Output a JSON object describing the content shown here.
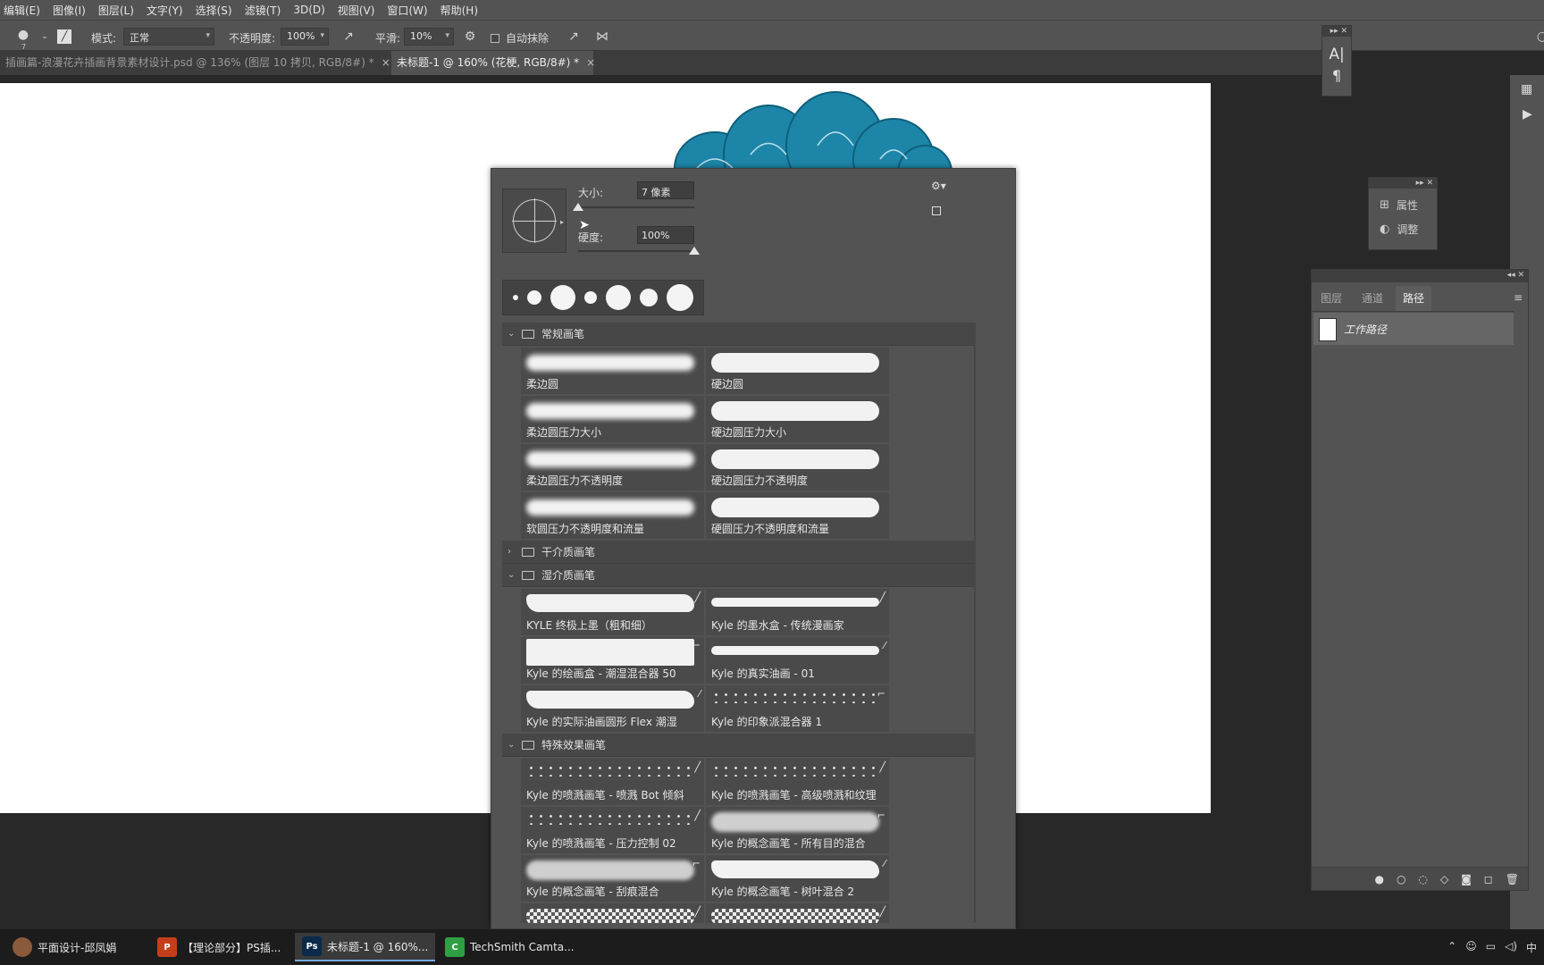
{
  "menu": [
    "编辑(E)",
    "图像(I)",
    "图层(L)",
    "文字(Y)",
    "选择(S)",
    "滤镜(T)",
    "3D(D)",
    "视图(V)",
    "窗口(W)",
    "帮助(H)"
  ],
  "options": {
    "brush_size_small": "7",
    "mode_label": "模式:",
    "mode_value": "正常",
    "opacity_label": "不透明度:",
    "opacity_value": "100%",
    "smooth_label": "平滑:",
    "smooth_value": "10%",
    "auto_erase_label": "自动抹除"
  },
  "tabs": [
    {
      "label": "插画篇-浪漫花卉插画背景素材设计.psd @ 136% (图层 10 拷贝, RGB/8#) *",
      "active": false
    },
    {
      "label": "未标题-1 @ 160% (花梗, RGB/8#) *",
      "active": true
    }
  ],
  "brush_panel": {
    "size_label": "大小:",
    "size_value": "7 像素",
    "hardness_label": "硬度:",
    "hardness_value": "100%",
    "size_fraction": 0.0,
    "hardness_fraction": 1.0,
    "groups": [
      {
        "name": "常规画笔",
        "expanded": true,
        "brushes": [
          {
            "name": "柔边圆",
            "style": "soft",
            "mark": ""
          },
          {
            "name": "硬边圆",
            "style": "hard",
            "mark": ""
          },
          {
            "name": "柔边圆压力大小",
            "style": "soft",
            "mark": ""
          },
          {
            "name": "硬边圆压力大小",
            "style": "hard",
            "mark": ""
          },
          {
            "name": "柔边圆压力不透明度",
            "style": "soft",
            "mark": ""
          },
          {
            "name": "硬边圆压力不透明度",
            "style": "hard",
            "mark": ""
          },
          {
            "name": "软圆压力不透明度和流量",
            "style": "soft",
            "mark": ""
          },
          {
            "name": "硬圆压力不透明度和流量",
            "style": "hard",
            "mark": ""
          }
        ]
      },
      {
        "name": "干介质画笔",
        "expanded": false,
        "brushes": []
      },
      {
        "name": "湿介质画笔",
        "expanded": true,
        "brushes": [
          {
            "name": "KYLE 终极上墨（粗和细）",
            "style": "rough",
            "mark": "╱"
          },
          {
            "name": "Kyle 的墨水盒 - 传统漫画家",
            "style": "thin",
            "mark": "╱"
          },
          {
            "name": "Kyle 的绘画盒 - 潮湿混合器 50",
            "style": "block",
            "mark": "⌐"
          },
          {
            "name": "Kyle 的真实油画 - 01",
            "style": "thin",
            "mark": "⁄"
          },
          {
            "name": "Kyle 的实际油画圆形 Flex 潮湿",
            "style": "rough",
            "mark": "⁄"
          },
          {
            "name": "Kyle 的印象派混合器 1",
            "style": "dots",
            "mark": "⌐"
          }
        ]
      },
      {
        "name": "特殊效果画笔",
        "expanded": true,
        "brushes": [
          {
            "name": "Kyle 的喷溅画笔 - 喷溅 Bot 倾斜",
            "style": "dots",
            "mark": "╱"
          },
          {
            "name": "Kyle 的喷溅画笔 - 高级喷溅和纹理",
            "style": "dots",
            "mark": "╱"
          },
          {
            "name": "Kyle 的喷溅画笔 - 压力控制 02",
            "style": "dots",
            "mark": "╱"
          },
          {
            "name": "Kyle 的概念画笔 - 所有目的混合",
            "style": "cloud",
            "mark": "⌐"
          },
          {
            "name": "Kyle 的概念画笔 - 刮痕混合",
            "style": "cloud",
            "mark": "⌐"
          },
          {
            "name": "Kyle 的概念画笔 - 树叶混合 2",
            "style": "rough",
            "mark": "⁄"
          },
          {
            "name": "",
            "style": "check",
            "mark": "╱"
          },
          {
            "name": "",
            "style": "check",
            "mark": "╱"
          }
        ]
      }
    ]
  },
  "char_panel": {
    "char_icon": "A|",
    "para_icon": "¶"
  },
  "props_panel": {
    "properties": "属性",
    "adjust": "调整"
  },
  "layers_panel": {
    "tabs": [
      "图层",
      "通道",
      "路径"
    ],
    "active_tab": 2,
    "path_name": "工作路径"
  },
  "taskbar": [
    {
      "label": "平面设计-邱凤娟",
      "icon": "",
      "color": "#8a5a3a",
      "active": false
    },
    {
      "label": "【理论部分】PS插...",
      "icon": "P",
      "color": "#c43e1c",
      "active": false
    },
    {
      "label": "未标题-1 @ 160%...",
      "icon": "Ps",
      "color": "#0b2a4a",
      "active": true
    },
    {
      "label": "TechSmith Camta...",
      "icon": "C",
      "color": "#2ea043",
      "active": false
    }
  ],
  "tray": {
    "ime": "中"
  },
  "colors": {
    "flower": "#1d86a8",
    "accent": "#79a8e0"
  }
}
